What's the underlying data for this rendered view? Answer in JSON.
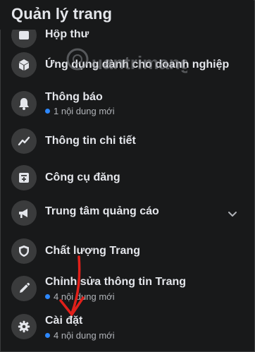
{
  "header": {
    "title": "Quản lý trang"
  },
  "menu": {
    "items": [
      {
        "label": "Hộp thư",
        "icon": "inbox-icon"
      },
      {
        "label": "Ứng dụng dành cho doanh nghiệp",
        "icon": "box-icon"
      },
      {
        "label": "Thông báo",
        "sub": "1 nội dung mới",
        "icon": "bell-icon"
      },
      {
        "label": "Thông tin chi tiết",
        "icon": "chart-line-icon"
      },
      {
        "label": "Công cụ đăng",
        "icon": "publishing-tools-icon"
      },
      {
        "label": "Trung tâm quảng cáo",
        "icon": "megaphone-icon"
      },
      {
        "label": "Chất lượng Trang",
        "icon": "shield-icon"
      },
      {
        "label": "Chỉnh sửa thông tin Trang",
        "sub": "4 nội dung mới",
        "icon": "pencil-icon"
      },
      {
        "label": "Cài đặt",
        "sub": "4 nội dung mới",
        "icon": "gear-icon"
      }
    ]
  },
  "colors": {
    "background": "#18191a",
    "icon_bg": "#3a3b3c",
    "badge_dot": "#2d88ff",
    "arrow": "#e0201a"
  },
  "watermark": {
    "brand": "uantrimang"
  }
}
